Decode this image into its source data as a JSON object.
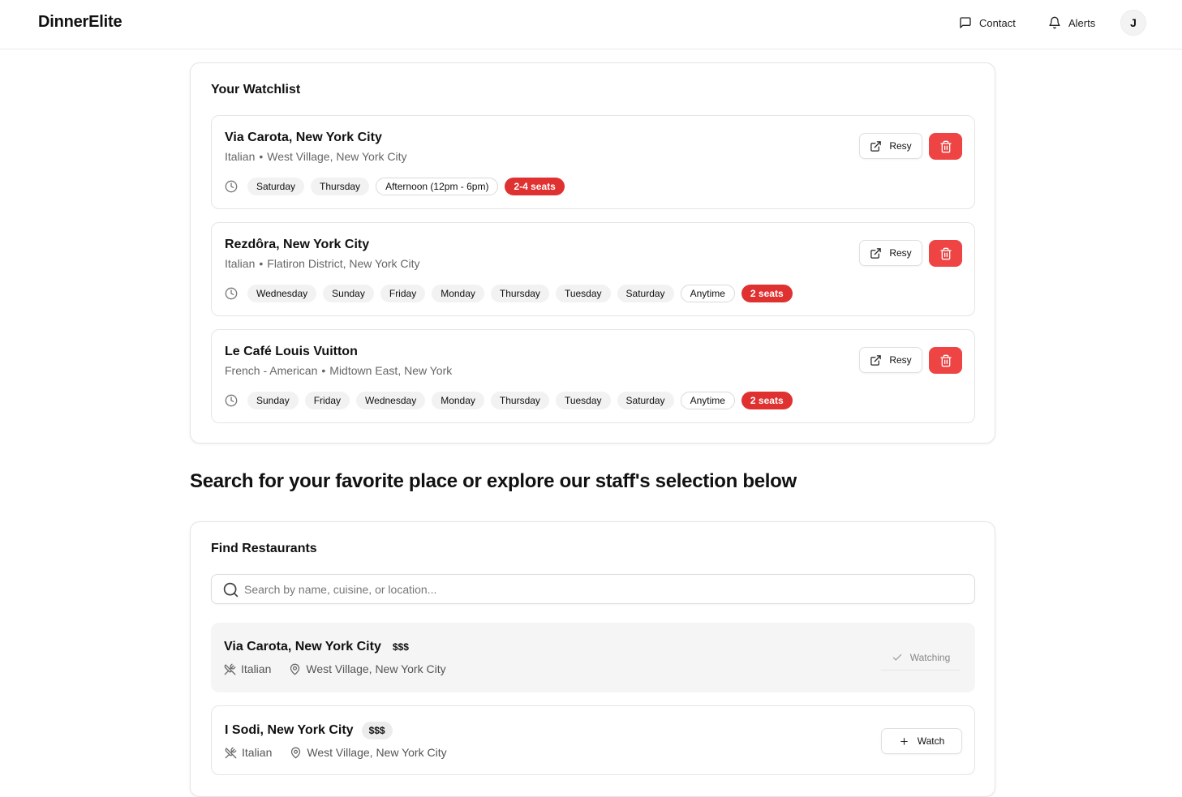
{
  "header": {
    "brand": "DinnerElite",
    "contact_label": "Contact",
    "alerts_label": "Alerts",
    "avatar_initial": "J"
  },
  "watchlist": {
    "title": "Your Watchlist",
    "resy_label": "Resy",
    "items": [
      {
        "name": "Via Carota, New York City",
        "cuisine": "Italian",
        "location": "West Village, New York City",
        "days": [
          "Saturday",
          "Thursday"
        ],
        "time": "Afternoon (12pm - 6pm)",
        "seats": "2-4 seats"
      },
      {
        "name": "Rezdôra, New York City",
        "cuisine": "Italian",
        "location": "Flatiron District, New York City",
        "days": [
          "Wednesday",
          "Sunday",
          "Friday",
          "Monday",
          "Thursday",
          "Tuesday",
          "Saturday"
        ],
        "time": "Anytime",
        "seats": "2 seats"
      },
      {
        "name": "Le Café Louis Vuitton",
        "cuisine": "French - American",
        "location": "Midtown East, New York",
        "days": [
          "Sunday",
          "Friday",
          "Wednesday",
          "Monday",
          "Thursday",
          "Tuesday",
          "Saturday"
        ],
        "time": "Anytime",
        "seats": "2 seats"
      }
    ]
  },
  "explore_heading": "Search for your favorite place or explore our staff's selection below",
  "find": {
    "title": "Find Restaurants",
    "search_placeholder": "Search by name, cuisine, or location...",
    "watching_label": "Watching",
    "watch_label": "Watch",
    "results": [
      {
        "name": "Via Carota, New York City",
        "price": "$$$",
        "cuisine": "Italian",
        "location": "West Village, New York City",
        "watching": true
      },
      {
        "name": "I Sodi, New York City",
        "price": "$$$",
        "cuisine": "Italian",
        "location": "West Village, New York City",
        "watching": false
      }
    ]
  },
  "colors": {
    "accent_red": "#ef4444",
    "seats_red": "#e03131"
  }
}
